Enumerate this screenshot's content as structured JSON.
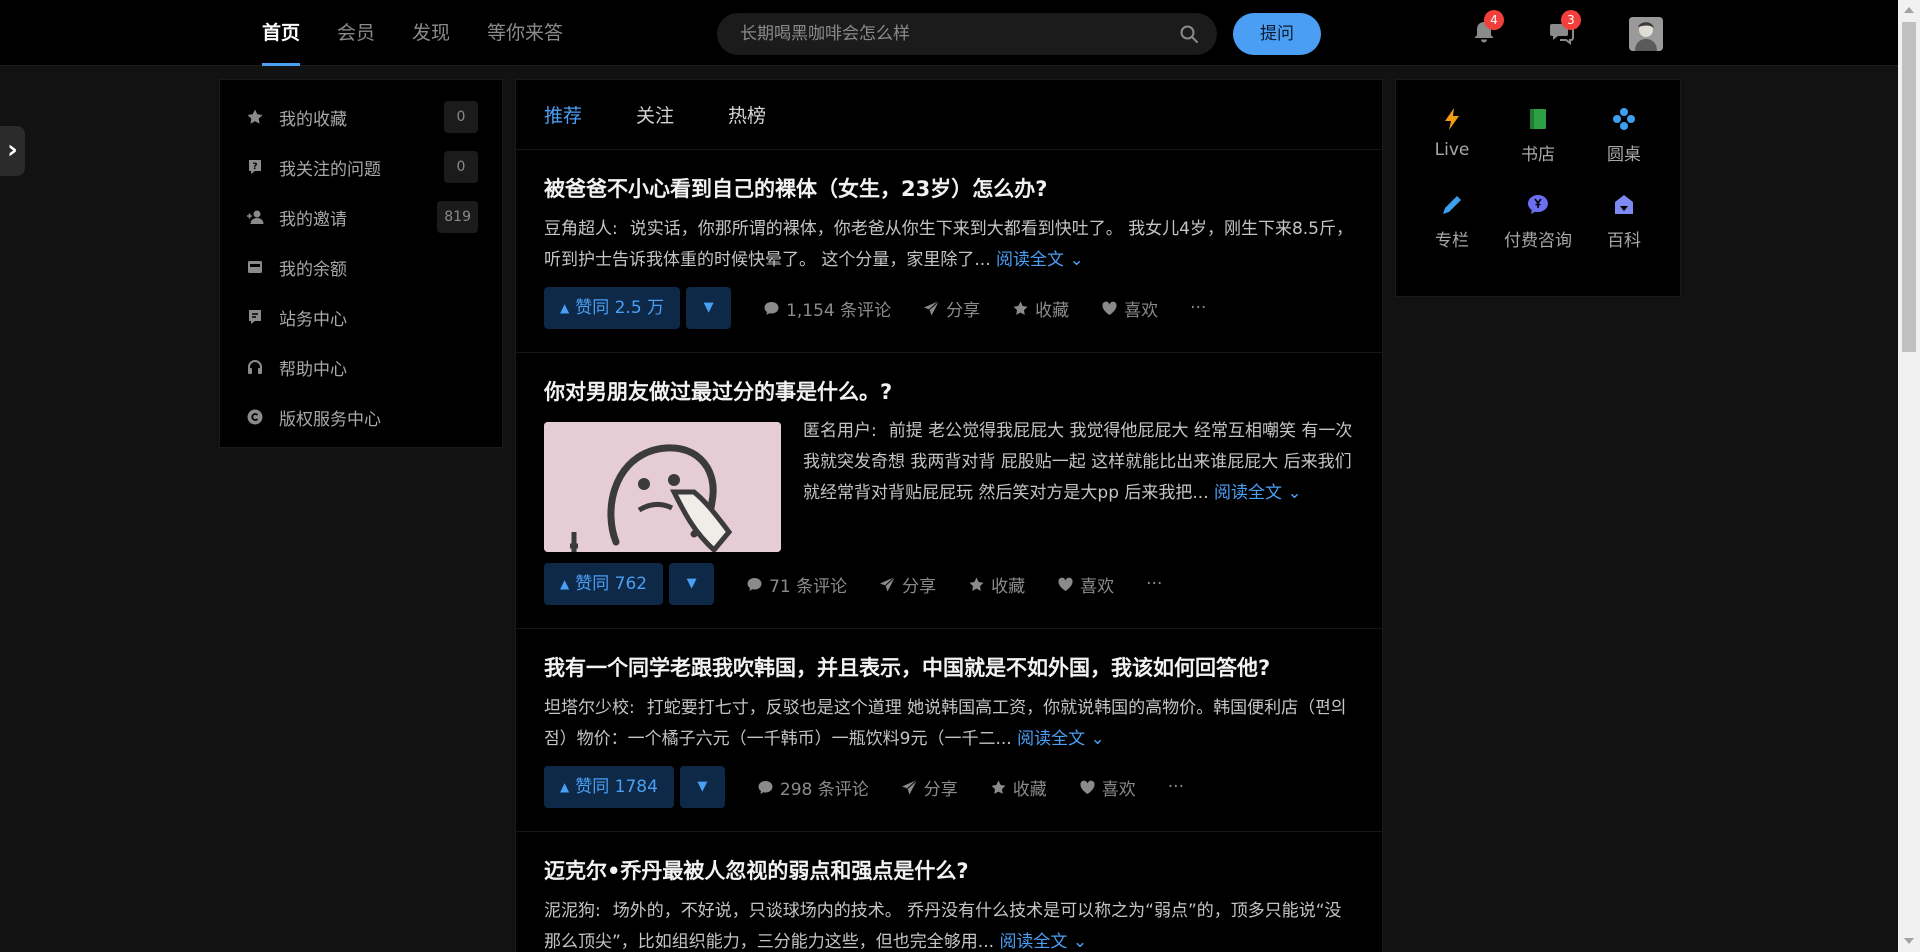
{
  "topbar": {
    "nav": [
      "首页",
      "会员",
      "发现",
      "等你来答"
    ],
    "search_placeholder": "长期喝黑咖啡会怎么样",
    "ask_label": "提问",
    "notifications_count": "4",
    "messages_count": "3"
  },
  "sidebar": {
    "items": [
      {
        "label": "我的收藏",
        "count": "0",
        "icon": "star-icon"
      },
      {
        "label": "我关注的问题",
        "count": "0",
        "icon": "question-icon"
      },
      {
        "label": "我的邀请",
        "count": "819",
        "icon": "add-user-icon"
      },
      {
        "label": "我的余额",
        "icon": "wallet-icon"
      },
      {
        "label": "站务中心",
        "icon": "chat-square-icon"
      },
      {
        "label": "帮助中心",
        "icon": "headset-icon"
      },
      {
        "label": "版权服务中心",
        "icon": "copyright-icon"
      }
    ]
  },
  "feed": {
    "tabs": [
      "推荐",
      "关注",
      "热榜"
    ],
    "cards": [
      {
        "title": "被爸爸不小心看到自己的裸体（女生，23岁）怎么办?",
        "author": "豆角超人:",
        "excerpt": "说实话，你那所谓的裸体，你老爸从你生下来到大都看到快吐了。 我女儿4岁，刚生下来8.5斤，听到护士告诉我体重的时候快晕了。 这个分量，家里除了...",
        "read_more": "阅读全文",
        "votes": "赞同 2.5 万",
        "comments": "1,154 条评论"
      },
      {
        "title": "你对男朋友做过最过分的事是什么。?",
        "author": "匿名用户:",
        "excerpt": "前提 老公觉得我屁屁大 我觉得他屁屁大 经常互相嘲笑 有一次我就突发奇想 我两背对背 屁股贴一起 这样就能比出来谁屁屁大 后来我们就经常背对背贴屁屁玩 然后笑对方是大pp 后来我把...",
        "read_more": "阅读全文",
        "votes": "赞同 762",
        "comments": "71 条评论"
      },
      {
        "title": "我有一个同学老跟我吹韩国，并且表示，中国就是不如外国，我该如何回答他?",
        "author": "坦塔尔少校:",
        "excerpt": "打蛇要打七寸，反驳也是这个道理 她说韩国高工资，你就说韩国的高物价。韩国便利店（편의점）物价：一个橘子六元（一千韩币）一瓶饮料9元（一千二...",
        "read_more": "阅读全文",
        "votes": "赞同 1784",
        "comments": "298 条评论"
      },
      {
        "title": "迈克尔•乔丹最被人忽视的弱点和强点是什么?",
        "author": "泥泥狗:",
        "excerpt": "场外的，不好说，只谈球场内的技术。 乔丹没有什么技术是可以称之为“弱点”的，顶多只能说“没那么顶尖”，比如组织能力，三分能力这些，但也完全够用...",
        "read_more": "阅读全文",
        "votes": "",
        "comments": ""
      }
    ],
    "share_label": "分享",
    "collect_label": "收藏",
    "like_label": "喜欢",
    "more_label": "···"
  },
  "right_panel": {
    "items": [
      "Live",
      "书店",
      "圆桌",
      "专栏",
      "付费咨询",
      "百科"
    ]
  },
  "colors": {
    "accent": "#4a9ff5",
    "background": "#121212",
    "panel": "#000000",
    "badge": "#f1403c"
  }
}
